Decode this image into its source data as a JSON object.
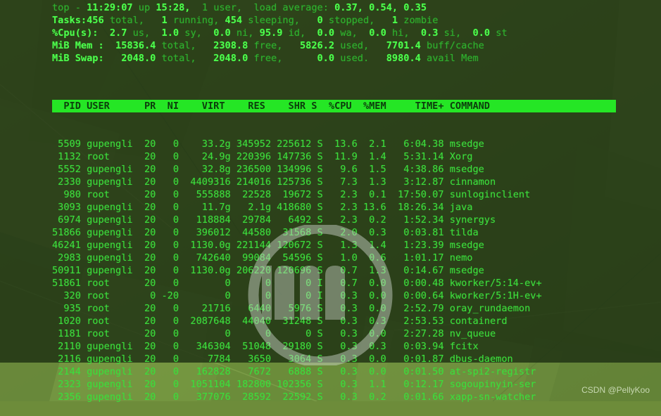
{
  "desktop": {
    "credit": "CSDN @PellyKoo",
    "watermark_icon": "linux-mint-logo-watermark"
  },
  "terminal": {
    "summary": {
      "line1": {
        "prefix": "top - ",
        "time": "11:29:07",
        "up_label": " up ",
        "uptime": "15:28,",
        "users": "  1 user,  ",
        "load_label": "load average: ",
        "load": "0.37, 0.54, 0.35"
      },
      "line2": {
        "label": "Tasks:",
        "total_val": "456",
        "total_lbl": " total,   ",
        "running_val": "1",
        "running_lbl": " running, ",
        "sleeping_val": "454",
        "sleeping_lbl": " sleeping,   ",
        "stopped_val": "0",
        "stopped_lbl": " stopped,   ",
        "zombie_val": "1",
        "zombie_lbl": " zombie"
      },
      "line3": {
        "label": "%Cpu(s):  ",
        "us_val": "2.7",
        "us_lbl": " us,  ",
        "sy_val": "1.0",
        "sy_lbl": " sy,  ",
        "ni_val": "0.0",
        "ni_lbl": " ni, ",
        "id_val": "95.9",
        "id_lbl": " id,  ",
        "wa_val": "0.0",
        "wa_lbl": " wa,  ",
        "hi_val": "0.0",
        "hi_lbl": " hi,  ",
        "si_val": "0.3",
        "si_lbl": " si,  ",
        "st_val": "0.0",
        "st_lbl": " st"
      },
      "line4": {
        "label": "MiB Mem :  ",
        "total_val": "15836.4",
        "total_lbl": " total,   ",
        "free_val": "2308.8",
        "free_lbl": " free,   ",
        "used_val": "5826.2",
        "used_lbl": " used,   ",
        "buff_val": "7701.4",
        "buff_lbl": " buff/cache"
      },
      "line5": {
        "label": "MiB Swap:   ",
        "total_val": "2048.0",
        "total_lbl": " total,   ",
        "free_val": "2048.0",
        "free_lbl": " free,      ",
        "used_val": "0.0",
        "used_lbl": " used.   ",
        "avail_val": "8980.4",
        "avail_lbl": " avail Mem"
      }
    },
    "table": {
      "header": "  PID USER      PR  NI    VIRT    RES    SHR S  %CPU  %MEM     TIME+ COMMAND",
      "columns": [
        "PID",
        "USER",
        "PR",
        "NI",
        "VIRT",
        "RES",
        "SHR",
        "S",
        "%CPU",
        "%MEM",
        "TIME+",
        "COMMAND"
      ],
      "rows": [
        {
          "pid": "5509",
          "user": "gupengli",
          "pr": "20",
          "ni": "0",
          "virt": "33.2g",
          "res": "345952",
          "shr": "225612",
          "s": "S",
          "cpu": "13.6",
          "mem": "2.1",
          "time": "6:04.38",
          "command": "msedge"
        },
        {
          "pid": "1132",
          "user": "root",
          "pr": "20",
          "ni": "0",
          "virt": "24.9g",
          "res": "220396",
          "shr": "147736",
          "s": "S",
          "cpu": "11.9",
          "mem": "1.4",
          "time": "5:31.14",
          "command": "Xorg"
        },
        {
          "pid": "5552",
          "user": "gupengli",
          "pr": "20",
          "ni": "0",
          "virt": "32.8g",
          "res": "236500",
          "shr": "134996",
          "s": "S",
          "cpu": "9.6",
          "mem": "1.5",
          "time": "4:38.86",
          "command": "msedge"
        },
        {
          "pid": "2330",
          "user": "gupengli",
          "pr": "20",
          "ni": "0",
          "virt": "4409316",
          "res": "214016",
          "shr": "125736",
          "s": "S",
          "cpu": "7.3",
          "mem": "1.3",
          "time": "3:12.87",
          "command": "cinnamon"
        },
        {
          "pid": "980",
          "user": "root",
          "pr": "20",
          "ni": "0",
          "virt": "555888",
          "res": "22528",
          "shr": "19672",
          "s": "S",
          "cpu": "2.3",
          "mem": "0.1",
          "time": "17:50.07",
          "command": "sunloginclient"
        },
        {
          "pid": "3093",
          "user": "gupengli",
          "pr": "20",
          "ni": "0",
          "virt": "11.7g",
          "res": "2.1g",
          "shr": "418680",
          "s": "S",
          "cpu": "2.3",
          "mem": "13.6",
          "time": "18:26.34",
          "command": "java"
        },
        {
          "pid": "6974",
          "user": "gupengli",
          "pr": "20",
          "ni": "0",
          "virt": "118884",
          "res": "29784",
          "shr": "6492",
          "s": "S",
          "cpu": "2.3",
          "mem": "0.2",
          "time": "1:52.34",
          "command": "synergys"
        },
        {
          "pid": "51866",
          "user": "gupengli",
          "pr": "20",
          "ni": "0",
          "virt": "396012",
          "res": "44580",
          "shr": "31568",
          "s": "S",
          "cpu": "2.0",
          "mem": "0.3",
          "time": "0:03.81",
          "command": "tilda"
        },
        {
          "pid": "46241",
          "user": "gupengli",
          "pr": "20",
          "ni": "0",
          "virt": "1130.0g",
          "res": "221144",
          "shr": "120672",
          "s": "S",
          "cpu": "1.3",
          "mem": "1.4",
          "time": "1:23.39",
          "command": "msedge"
        },
        {
          "pid": "2983",
          "user": "gupengli",
          "pr": "20",
          "ni": "0",
          "virt": "742640",
          "res": "99084",
          "shr": "54596",
          "s": "S",
          "cpu": "1.0",
          "mem": "0.6",
          "time": "1:01.17",
          "command": "nemo"
        },
        {
          "pid": "50911",
          "user": "gupengli",
          "pr": "20",
          "ni": "0",
          "virt": "1130.0g",
          "res": "206220",
          "shr": "120696",
          "s": "S",
          "cpu": "0.7",
          "mem": "1.3",
          "time": "0:14.67",
          "command": "msedge"
        },
        {
          "pid": "51861",
          "user": "root",
          "pr": "20",
          "ni": "0",
          "virt": "0",
          "res": "0",
          "shr": "0",
          "s": "I",
          "cpu": "0.7",
          "mem": "0.0",
          "time": "0:00.48",
          "command": "kworker/5:14-ev+"
        },
        {
          "pid": "320",
          "user": "root",
          "pr": "0",
          "ni": "-20",
          "virt": "0",
          "res": "0",
          "shr": "0",
          "s": "I",
          "cpu": "0.3",
          "mem": "0.0",
          "time": "0:00.64",
          "command": "kworker/5:1H-ev+"
        },
        {
          "pid": "935",
          "user": "root",
          "pr": "20",
          "ni": "0",
          "virt": "21716",
          "res": "6440",
          "shr": "5976",
          "s": "S",
          "cpu": "0.3",
          "mem": "0.0",
          "time": "2:52.79",
          "command": "oray_rundaemon"
        },
        {
          "pid": "1020",
          "user": "root",
          "pr": "20",
          "ni": "0",
          "virt": "2087648",
          "res": "44040",
          "shr": "31248",
          "s": "S",
          "cpu": "0.3",
          "mem": "0.3",
          "time": "2:53.53",
          "command": "containerd"
        },
        {
          "pid": "1181",
          "user": "root",
          "pr": "20",
          "ni": "0",
          "virt": "0",
          "res": "0",
          "shr": "0",
          "s": "S",
          "cpu": "0.3",
          "mem": "0.0",
          "time": "2:27.28",
          "command": "nv_queue"
        },
        {
          "pid": "2110",
          "user": "gupengli",
          "pr": "20",
          "ni": "0",
          "virt": "346304",
          "res": "51048",
          "shr": "29180",
          "s": "S",
          "cpu": "0.3",
          "mem": "0.3",
          "time": "0:03.94",
          "command": "fcitx"
        },
        {
          "pid": "2116",
          "user": "gupengli",
          "pr": "20",
          "ni": "0",
          "virt": "7784",
          "res": "3650",
          "shr": "3064",
          "s": "S",
          "cpu": "0.3",
          "mem": "0.0",
          "time": "0:01.87",
          "command": "dbus-daemon"
        },
        {
          "pid": "2144",
          "user": "gupengli",
          "pr": "20",
          "ni": "0",
          "virt": "162828",
          "res": "7672",
          "shr": "6888",
          "s": "S",
          "cpu": "0.3",
          "mem": "0.0",
          "time": "0:01.50",
          "command": "at-spi2-registr"
        },
        {
          "pid": "2323",
          "user": "gupengli",
          "pr": "20",
          "ni": "0",
          "virt": "1051104",
          "res": "182800",
          "shr": "102356",
          "s": "S",
          "cpu": "0.3",
          "mem": "1.1",
          "time": "0:12.17",
          "command": "sogoupinyin-ser"
        },
        {
          "pid": "2356",
          "user": "gupengli",
          "pr": "20",
          "ni": "0",
          "virt": "377076",
          "res": "28592",
          "shr": "22592",
          "s": "S",
          "cpu": "0.3",
          "mem": "0.2",
          "time": "0:01.66",
          "command": "xapp-sn-watcher"
        }
      ]
    }
  },
  "colors": {
    "terminal_bg": "#1c2e12",
    "text_green": "#3ddc3d",
    "bright_green": "#4dff4d",
    "header_bar_bg": "#25e625",
    "header_bar_fg": "#0c3d0c",
    "wallpaper_green": "#6d8c3a"
  }
}
